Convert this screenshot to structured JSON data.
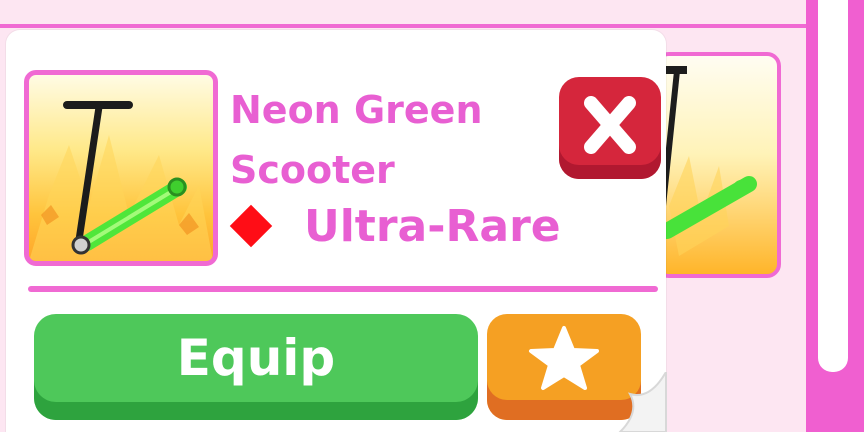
{
  "item": {
    "name": "Neon Green Scooter",
    "rarity": "Ultra-Rare"
  },
  "actions": {
    "equip_label": "Equip"
  },
  "icons": {
    "thumbnail": "neon-green-scooter",
    "rarity": "red-diamond-icon",
    "close": "x-icon",
    "favorite": "star-icon"
  },
  "colors": {
    "accent_pink": "#f06ad3",
    "text_pink": "#e85fd2",
    "rarity_red": "#ff0d16",
    "close_red": "#d5263c",
    "equip_green": "#4ec85a",
    "favorite_orange": "#f5a023"
  }
}
